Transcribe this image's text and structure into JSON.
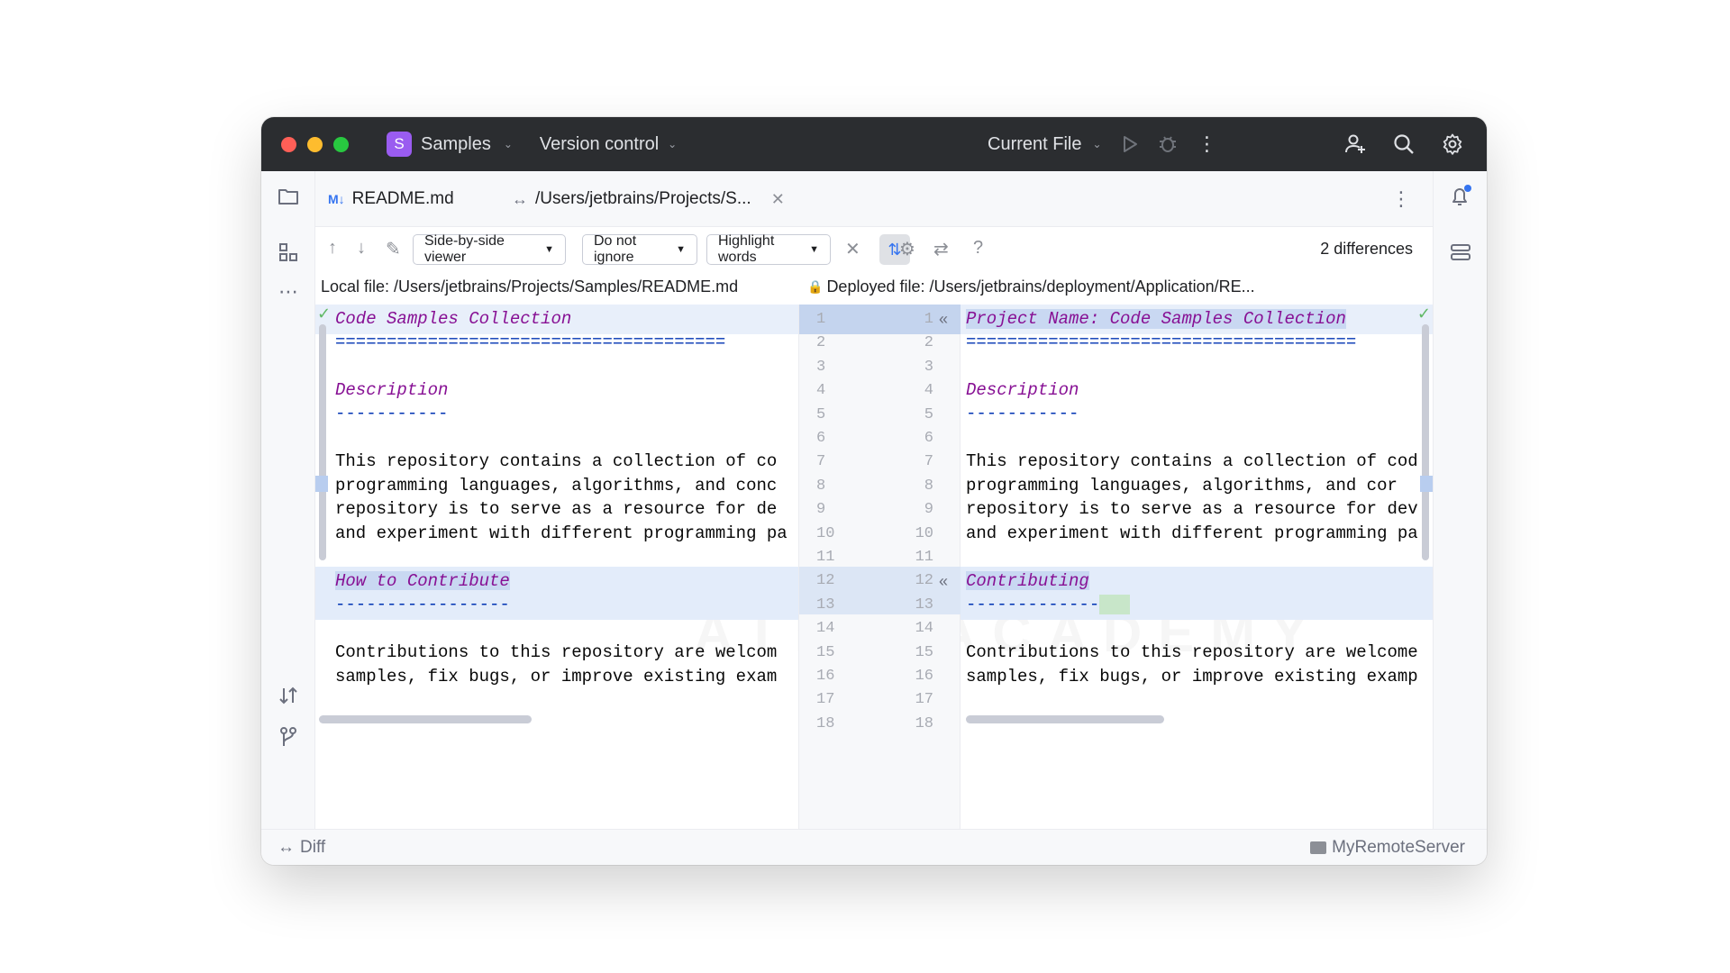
{
  "titlebar": {
    "project_initial": "S",
    "project_name": "Samples",
    "vcs": "Version control",
    "run_config": "Current File"
  },
  "tabs": [
    {
      "badge": "M↓",
      "label": "README.md"
    },
    {
      "label": "/Users/jetbrains/Projects/S..."
    }
  ],
  "toolbar": {
    "viewer": "Side-by-side viewer",
    "ignore": "Do not ignore",
    "highlight": "Highlight words",
    "diff_count": "2 differences",
    "help": "?"
  },
  "files": {
    "left": "Local file: /Users/jetbrains/Projects/Samples/README.md",
    "right": "Deployed file: /Users/jetbrains/deployment/Application/RE..."
  },
  "left_lines": [
    "Code Samples Collection",
    "======================================",
    "",
    "Description",
    "-----------",
    "",
    "This repository contains a collection of co",
    "programming languages, algorithms, and conc",
    "repository is to serve as a resource for de",
    "and experiment with different programming pa",
    "",
    "How to Contribute",
    "-----------------",
    "",
    "Contributions to this repository are welcom",
    "samples, fix bugs, or improve existing exam",
    "",
    ""
  ],
  "right_lines": [
    "Project Name: Code Samples Collection",
    "======================================",
    "",
    "Description",
    "-----------",
    "",
    "This repository contains a collection of cod",
    "programming languages, algorithms, and cor",
    "repository is to serve as a resource for dev",
    "and experiment with different programming pa",
    "",
    "Contributing",
    "-------------",
    "",
    "Contributions to this repository are welcome",
    "samples, fix bugs, or improve existing examp",
    "",
    ""
  ],
  "line_numbers": [
    "1",
    "2",
    "3",
    "4",
    "5",
    "6",
    "7",
    "8",
    "9",
    "10",
    "11",
    "12",
    "13",
    "14",
    "15",
    "16",
    "17",
    "18"
  ],
  "status": {
    "left": "Diff",
    "right": "MyRemoteServer"
  },
  "colors": {
    "accent": "#3574f0",
    "titlebar": "#2b2d30",
    "change_bg": "#e8effa",
    "project_badge": "#9a5cf0"
  }
}
